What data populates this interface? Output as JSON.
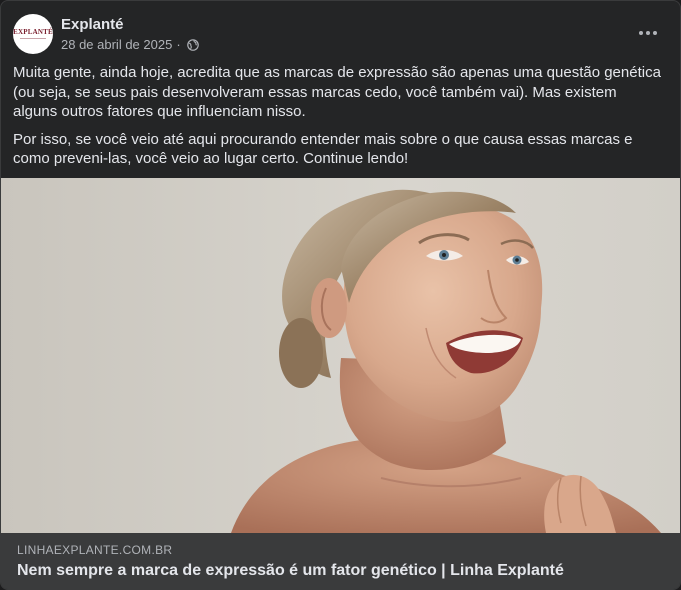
{
  "post": {
    "author": "Explanté",
    "avatar_text": "EXPLANTÉ",
    "date": "28 de abril de 2025",
    "separator": "·",
    "privacy_icon": "globe-icon",
    "more_icon": "more-horizontal-icon",
    "paragraphs": [
      "Muita gente, ainda hoje, acredita que as marcas de expressão são apenas uma questão genética (ou seja, se seus pais desenvolveram essas marcas cedo, você também vai). Mas existem alguns outros fatores que influenciam nisso.",
      "Por isso, se você veio até aqui procurando entender mais sobre o que causa essas marcas e como preveni-las, você veio ao lugar certo. Continue lendo!"
    ]
  },
  "link_preview": {
    "image_subject": "smiling mature woman with bare shoulders against neutral background",
    "domain": "LINHAEXPLANTE.COM.BR",
    "title": "Nem sempre a marca de expressão é um fator genético | Linha Explanté"
  },
  "colors": {
    "card_bg": "#242526",
    "footer_bg": "#3a3b3c",
    "text_primary": "#e4e6eb",
    "text_secondary": "#b0b3b8",
    "brand": "#7a1f2e"
  }
}
